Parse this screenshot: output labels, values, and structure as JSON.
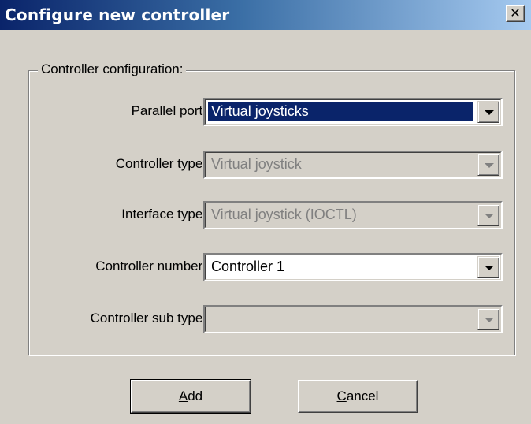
{
  "window": {
    "title": "Configure new controller",
    "close_icon": "close-icon"
  },
  "group": {
    "label": "Controller configuration:"
  },
  "fields": {
    "parallel_port": {
      "label": "Parallel port:",
      "value": "Virtual joysticks",
      "enabled": true,
      "selected": true
    },
    "controller_type": {
      "label": "Controller type:",
      "value": "Virtual joystick",
      "enabled": false
    },
    "interface_type": {
      "label": "Interface type:",
      "value": "Virtual joystick (IOCTL)",
      "enabled": false
    },
    "controller_number": {
      "label": "Controller number:",
      "value": "Controller 1",
      "enabled": true
    },
    "controller_sub_type": {
      "label": "Controller sub type:",
      "value": "",
      "enabled": false
    }
  },
  "buttons": {
    "add": {
      "mnemonic": "A",
      "rest": "dd"
    },
    "cancel": {
      "mnemonic": "C",
      "rest": "ancel"
    }
  },
  "colors": {
    "title_gradient_start": "#0a246a",
    "title_gradient_end": "#a6caf0",
    "selection": "#0a246a",
    "face": "#d4d0c8"
  }
}
